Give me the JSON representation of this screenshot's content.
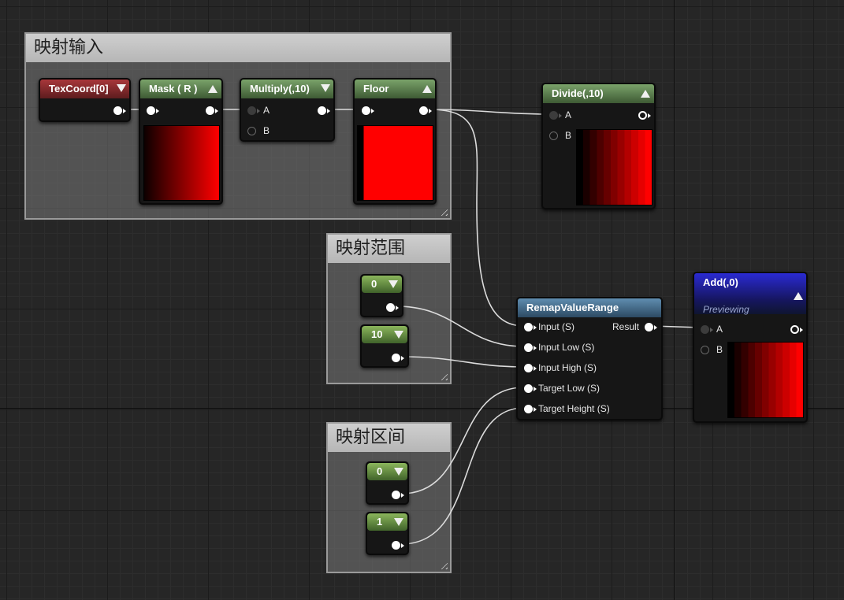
{
  "comments": {
    "input": "映射输入",
    "range": "映射范围",
    "interval": "映射区间"
  },
  "nodes": {
    "texcoord": {
      "title": "TexCoord[0]",
      "color": "#a8373a"
    },
    "mask": {
      "title": "Mask ( R )"
    },
    "multiply": {
      "title": "Multiply(,10)",
      "pin_a": "A",
      "pin_b": "B"
    },
    "floor": {
      "title": "Floor"
    },
    "divide": {
      "title": "Divide(,10)",
      "pin_a": "A",
      "pin_b": "B"
    },
    "remap": {
      "title": "RemapValueRange",
      "inputs": [
        "Input (S)",
        "Input Low (S)",
        "Input High (S)",
        "Target Low (S)",
        "Target Height (S)"
      ],
      "output": "Result",
      "color": "#5f8db0"
    },
    "add": {
      "title": "Add(,0)",
      "subtitle": "Previewing",
      "pin_a": "A",
      "pin_b": "B",
      "color": "#2a2ad2"
    },
    "const_range_low": {
      "value": "0"
    },
    "const_range_high": {
      "value": "10"
    },
    "const_target_low": {
      "value": "0"
    },
    "const_target_high": {
      "value": "1"
    }
  },
  "icons": {
    "collapse": "triangle-up",
    "expand": "triangle-down",
    "pin": "circle-pin"
  }
}
